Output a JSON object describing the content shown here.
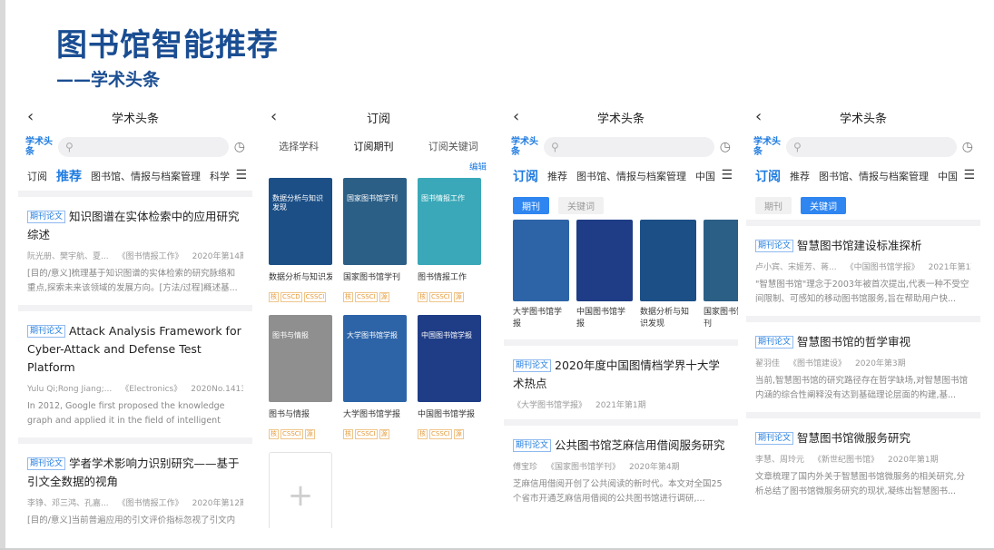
{
  "page": {
    "title": "图书馆智能推荐",
    "subtitle": "——学术头条"
  },
  "icons": {
    "back": "chevron-left-icon",
    "search": "search-icon",
    "history": "clock-icon",
    "menu": "menu-icon",
    "add": "plus-icon"
  },
  "colors": {
    "title": "#1a4d92",
    "accent": "#1f7be0",
    "tag": "#e59b3c"
  },
  "logo_text": "学术头条",
  "screen1": {
    "nav_title": "学术头条",
    "tabs": [
      "订阅",
      "推荐",
      "图书馆、情报与档案管理",
      "科学"
    ],
    "articles": [
      {
        "badge": "期刊论文",
        "title": "知识图谱在实体检索中的应用研究综述",
        "authors": "阮光册、樊宇航、夏...",
        "journal": "《图书情报工作》",
        "issue": "2020年第14期",
        "abstract": "[目的/意义]梳理基于知识图谱的实体检索的研究脉络和重点,探索未来该领域的发展方向。[方法/过程]概述基..."
      },
      {
        "badge": "期刊论文",
        "title": "Attack Analysis Framework for Cyber-Attack and Defense Test Platform",
        "authors": "Yulu Qi;Rong Jiang;...",
        "journal": "《Electronics》",
        "issue": "2020No.1413",
        "abstract": "In 2012, Google first proposed the knowledge graph and applied it in the field of intelligent searching...."
      },
      {
        "badge": "期刊论文",
        "title": "学者学术影响力识别研究——基于引文全数据的视角",
        "authors": "李铮、邓三鸿、孔嘉...",
        "journal": "《图书情报工作》",
        "issue": "2020年第12期",
        "abstract": "[目的/意义]当前普遍应用的引文评价指标忽视了引文内"
      }
    ]
  },
  "screen2": {
    "nav_title": "订阅",
    "subtabs": [
      "选择学科",
      "订阅期刊",
      "订阅关键词"
    ],
    "edit": "编辑",
    "journals": [
      {
        "name": "数据分析与知识发现",
        "tags": [
          "核",
          "CSCD",
          "CSSCI"
        ],
        "cover": "#1c4f86",
        "cover_text": "数据分析与知识发现"
      },
      {
        "name": "国家图书馆学刊",
        "tags": [
          "核",
          "CSSCI",
          "源"
        ],
        "cover": "#2c5f86",
        "cover_text": "国家图书馆学刊"
      },
      {
        "name": "图书情报工作",
        "tags": [
          "核",
          "CSSCI",
          "源"
        ],
        "cover": "#3aa8b8",
        "cover_text": "图书情报工作"
      },
      {
        "name": "图书与情报",
        "tags": [
          "核",
          "CSSCI",
          "源"
        ],
        "cover": "#8f8f8f",
        "cover_text": "图书与情报"
      },
      {
        "name": "大学图书馆学报",
        "tags": [
          "核",
          "CSSCI",
          "源"
        ],
        "cover": "#2d64a8",
        "cover_text": "大学图书馆学报"
      },
      {
        "name": "中国图书馆学报",
        "tags": [
          "核",
          "CSSCI",
          "源"
        ],
        "cover": "#1f3d86",
        "cover_text": "中国图书馆学报"
      }
    ],
    "add_symbol": "+"
  },
  "screen3": {
    "nav_title": "学术头条",
    "tabs": [
      "订阅",
      "推荐",
      "图书馆、情报与档案管理",
      "中国"
    ],
    "pills": [
      "期刊",
      "关键词"
    ],
    "journals": [
      {
        "name": "大学图书馆学报",
        "cover": "#2d64a8"
      },
      {
        "name": "中国图书馆学报",
        "cover": "#1f3d86"
      },
      {
        "name": "数据分析与知识发现",
        "cover": "#1c4f86"
      },
      {
        "name": "国家图书馆学刊",
        "cover": "#2c5f86"
      }
    ],
    "articles": [
      {
        "badge": "期刊论文",
        "title": "2020年度中国图情档学界十大学术热点",
        "authors": "",
        "journal": "《大学图书馆学报》",
        "issue": "2021年第1期",
        "abstract": ""
      },
      {
        "badge": "期刊论文",
        "title": "公共图书馆芝麻信用借阅服务研究",
        "authors": "傅宝珍",
        "journal": "《国家图书馆学刊》",
        "issue": "2020年第4期",
        "abstract": "芝麻信用借阅开创了公共阅读的新时代。本文对全国25个省市开通芝麻信用借阅的公共图书馆进行调研,..."
      }
    ]
  },
  "screen4": {
    "nav_title": "学术头条",
    "tabs": [
      "订阅",
      "推荐",
      "图书馆、情报与档案管理",
      "中国"
    ],
    "pills": [
      "期刊",
      "关键词"
    ],
    "articles": [
      {
        "badge": "期刊论文",
        "title": "智慧图书馆建设标准探析",
        "authors": "卢小宾、宋姬芳、蒋...",
        "journal": "《中国图书馆学报》",
        "issue": "2021年第1期",
        "abstract": "\"智慧图书馆\"理念于2003年被首次提出,代表一种不受空间限制、可感知的移动图书馆服务,旨在帮助用户快..."
      },
      {
        "badge": "期刊论文",
        "title": "智慧图书馆的哲学审视",
        "authors": "翟羽佳",
        "journal": "《图书馆建设》",
        "issue": "2020年第3期",
        "abstract": "当前,智慧图书馆的研究路径存在哲学缺场,对智慧图书馆内涵的综合性阐释没有达到基础理论层面的构建,基..."
      },
      {
        "badge": "期刊论文",
        "title": "智慧图书馆微服务研究",
        "authors": "李慧、周玲元",
        "journal": "《新世纪图书馆》",
        "issue": "2020年第1期",
        "abstract": "文章梳理了国内外关于智慧图书馆微服务的相关研究,分析总结了图书馆微服务研究的现状,凝练出智慧图书..."
      }
    ]
  }
}
